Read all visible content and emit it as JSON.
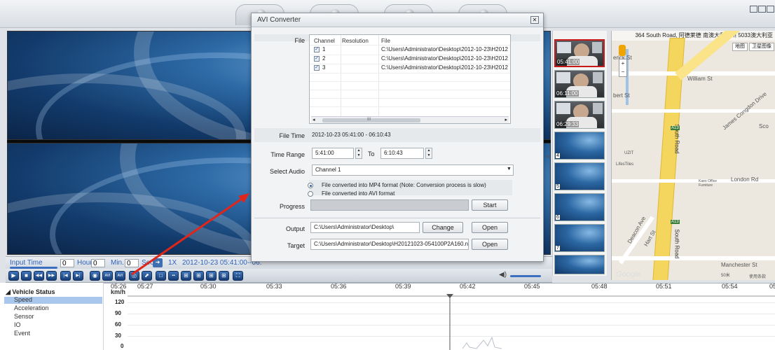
{
  "dialog": {
    "title": "AVI Converter",
    "close_glyph": "✕",
    "labels": {
      "file": "File",
      "file_time": "File Time",
      "time_range": "Time Range",
      "to": "To",
      "select_audio": "Select Audio",
      "progress": "Progress",
      "output": "Output",
      "target": "Target"
    },
    "file_table": {
      "headers": [
        "Channel",
        "Resolution",
        "File"
      ],
      "rows": [
        {
          "channel": "1",
          "checked": true,
          "path": "C:\\Users\\Administrator\\Desktop\\2012-10-23\\H2012"
        },
        {
          "channel": "2",
          "checked": true,
          "path": "C:\\Users\\Administrator\\Desktop\\2012-10-23\\H2012"
        },
        {
          "channel": "3",
          "checked": true,
          "path": "C:\\Users\\Administrator\\Desktop\\2012-10-23\\H2012"
        }
      ],
      "scroll_left": "◂",
      "scroll_right": "▸",
      "scroll_grip": "III"
    },
    "file_time_value": "2012-10-23 05:41:00 - 06:10:43",
    "time_from": "5:41:00",
    "time_to": "6:10:43",
    "audio_selected": "Channel 1",
    "format_options": [
      {
        "label": "File converted into MP4 format (Note: Conversion process is slow)",
        "selected": true
      },
      {
        "label": "File converted into AVI format",
        "selected": false
      }
    ],
    "start_label": "Start",
    "output_path": "C:\\Users\\Administrator\\Desktop\\",
    "change_label": "Change",
    "open_label": "Open",
    "target_path": "C:\\Users\\Administrator\\Desktop\\H20121023-054100P2A160.n",
    "open2_label": "Open"
  },
  "playback": {
    "input_time_label": "Input Time",
    "hour_value": "0",
    "hour_label": "Hour",
    "min_value": "0",
    "min_label": "Min.",
    "sec_value": "0",
    "sec_label": "Sec",
    "speed": "1X",
    "range_text": "2012-10-23 05:41:00--06:",
    "controls": [
      "play",
      "stop",
      "rewind",
      "fast-forward",
      "previous",
      "next",
      "snapshot",
      "avi-export",
      "avi-convert",
      "print",
      "chart",
      "layout-1",
      "layout-2",
      "layout-4",
      "layout-6",
      "layout-9",
      "layout-16",
      "fullscreen"
    ],
    "control_glyphs": [
      "▶",
      "■",
      "◀◀",
      "▶▶",
      "|◀",
      "▶|",
      "◉",
      "AVI",
      "AVI",
      "⎙",
      "⬈",
      "□",
      "▪▪",
      "⊞",
      "⊞",
      "⊞",
      "⊞",
      "⛶"
    ]
  },
  "thumbs": [
    {
      "label": "05:41:00",
      "kind": "cam",
      "selected": true
    },
    {
      "label": "06:11:00",
      "kind": "cam",
      "selected": false
    },
    {
      "label": "06:29:33",
      "kind": "cam",
      "selected": false
    },
    {
      "label": "4",
      "kind": "blue",
      "selected": false
    },
    {
      "label": "5",
      "kind": "blue",
      "selected": false
    },
    {
      "label": "6",
      "kind": "blue",
      "selected": false
    },
    {
      "label": "7",
      "kind": "blue",
      "selected": false
    },
    {
      "label": "",
      "kind": "blue",
      "selected": false
    }
  ],
  "map": {
    "address": "364 South Road, 阿德莱德 南澳大利亚州 5033澳大利亚",
    "btn_map": "地图",
    "btn_sat": "卫星图像",
    "streets": [
      "William St",
      "South Road",
      "James Congdon Drive",
      "London Rd",
      "Manchester St",
      "Deacon Ave",
      "Hart St",
      "Sco"
    ],
    "google": "Google",
    "corner_texts": [
      "erick St",
      "bert St",
      "UZIT",
      "LifesTiles",
      "Kaeo Office Furniture",
      "A13",
      "A13",
      "使用条款"
    ],
    "scale": "50米"
  },
  "vehicle_status": {
    "header": "Vehicle Status",
    "items": [
      "Speed",
      "Acceleration",
      "Sensor",
      "IO",
      "Event"
    ],
    "selected": "Speed",
    "unit": "km/h",
    "ticks": [
      "05:26",
      "05:27",
      "05:30",
      "05:33",
      "05:36",
      "05:39",
      "05:42",
      "05:45",
      "05:48",
      "05:51",
      "05:54",
      "05"
    ],
    "y_ticks": [
      "120",
      "90",
      "60",
      "30",
      "0"
    ]
  }
}
